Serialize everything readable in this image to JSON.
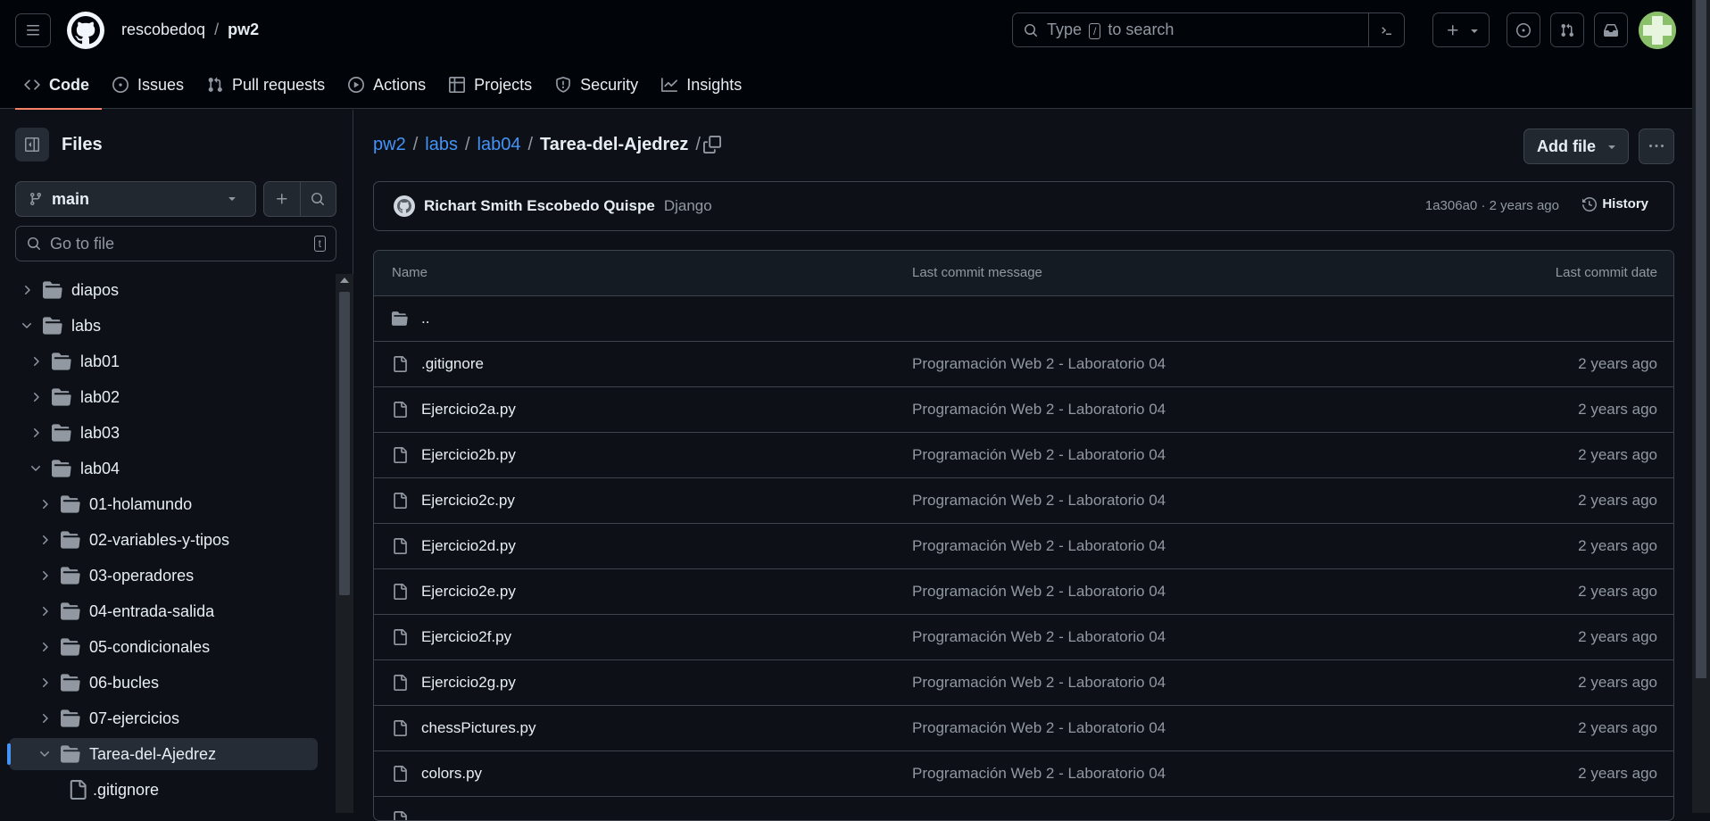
{
  "header": {
    "owner": "rescobedoq",
    "separator": "/",
    "repo": "pw2",
    "search_prefix": "Type",
    "search_key": "/",
    "search_suffix": "to search"
  },
  "tabs": [
    {
      "label": "Code",
      "icon": "code-icon"
    },
    {
      "label": "Issues",
      "icon": "issue-icon"
    },
    {
      "label": "Pull requests",
      "icon": "pull-request-icon"
    },
    {
      "label": "Actions",
      "icon": "play-icon"
    },
    {
      "label": "Projects",
      "icon": "table-icon"
    },
    {
      "label": "Security",
      "icon": "shield-icon"
    },
    {
      "label": "Insights",
      "icon": "graph-icon"
    }
  ],
  "sidebar": {
    "title": "Files",
    "branch": "main",
    "goto_placeholder": "Go to file",
    "goto_key": "t",
    "tree": [
      {
        "label": "diapos",
        "type": "folder",
        "expanded": false
      },
      {
        "label": "labs",
        "type": "folder",
        "expanded": true
      },
      {
        "label": "lab01",
        "type": "folder",
        "expanded": false
      },
      {
        "label": "lab02",
        "type": "folder",
        "expanded": false
      },
      {
        "label": "lab03",
        "type": "folder",
        "expanded": false
      },
      {
        "label": "lab04",
        "type": "folder",
        "expanded": true
      },
      {
        "label": "01-holamundo",
        "type": "folder",
        "expanded": false
      },
      {
        "label": "02-variables-y-tipos",
        "type": "folder",
        "expanded": false
      },
      {
        "label": "03-operadores",
        "type": "folder",
        "expanded": false
      },
      {
        "label": "04-entrada-salida",
        "type": "folder",
        "expanded": false
      },
      {
        "label": "05-condicionales",
        "type": "folder",
        "expanded": false
      },
      {
        "label": "06-bucles",
        "type": "folder",
        "expanded": false
      },
      {
        "label": "07-ejercicios",
        "type": "folder",
        "expanded": false
      },
      {
        "label": "Tarea-del-Ajedrez",
        "type": "folder",
        "expanded": true,
        "selected": true
      },
      {
        "label": ".gitignore",
        "type": "file"
      }
    ]
  },
  "breadcrumb": {
    "parts": [
      "pw2",
      "labs",
      "lab04"
    ],
    "current": "Tarea-del-Ajedrez",
    "sep": "/"
  },
  "actions": {
    "add_file": "Add file"
  },
  "commit": {
    "author": "Richart Smith Escobedo Quispe",
    "message": "Django",
    "meta": "1a306a0 · 2 years ago",
    "history": "History"
  },
  "table": {
    "col_name": "Name",
    "col_msg": "Last commit message",
    "col_date": "Last commit date",
    "parent": "..",
    "rows": [
      {
        "name": ".gitignore",
        "msg": "Programación Web 2 - Laboratorio 04",
        "date": "2 years ago"
      },
      {
        "name": "Ejercicio2a.py",
        "msg": "Programación Web 2 - Laboratorio 04",
        "date": "2 years ago"
      },
      {
        "name": "Ejercicio2b.py",
        "msg": "Programación Web 2 - Laboratorio 04",
        "date": "2 years ago"
      },
      {
        "name": "Ejercicio2c.py",
        "msg": "Programación Web 2 - Laboratorio 04",
        "date": "2 years ago"
      },
      {
        "name": "Ejercicio2d.py",
        "msg": "Programación Web 2 - Laboratorio 04",
        "date": "2 years ago"
      },
      {
        "name": "Ejercicio2e.py",
        "msg": "Programación Web 2 - Laboratorio 04",
        "date": "2 years ago"
      },
      {
        "name": "Ejercicio2f.py",
        "msg": "Programación Web 2 - Laboratorio 04",
        "date": "2 years ago"
      },
      {
        "name": "Ejercicio2g.py",
        "msg": "Programación Web 2 - Laboratorio 04",
        "date": "2 years ago"
      },
      {
        "name": "chessPictures.py",
        "msg": "Programación Web 2 - Laboratorio 04",
        "date": "2 years ago"
      },
      {
        "name": "colors.py",
        "msg": "Programación Web 2 - Laboratorio 04",
        "date": "2 years ago"
      }
    ]
  }
}
